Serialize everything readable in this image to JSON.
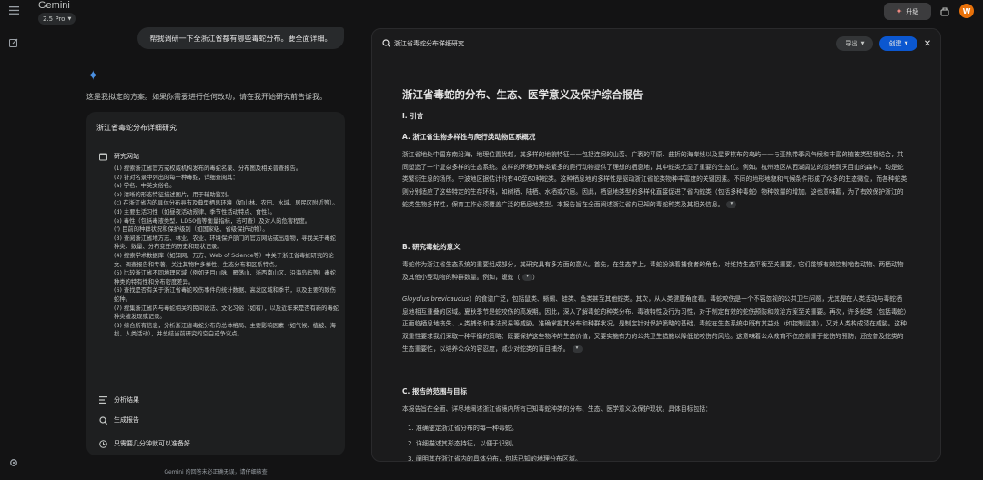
{
  "header": {
    "brand": "Gemini",
    "model": "2.5 Pro",
    "upgrade_label": "升级",
    "avatar_initial": "W"
  },
  "chat": {
    "user_message": "帮我调研一下全浙江省都有哪些毒蛇分布。要全面详细。",
    "plan_intro": "这是我拟定的方案。如果你需要进行任何改动，请在我开始研究前告诉我。",
    "plan": {
      "title": "浙江省毒蛇分布详细研究",
      "section_research": "研究网站",
      "steps": [
        "(1) 搜索浙江省官方或权威机构发布的毒蛇名录、分布图及相关普查报告。",
        "(2) 针对名录中列出的每一种毒蛇，详细查阅其：",
        "(a) 学名、中英文俗名。",
        "(b) 清晰的形态特征描述图片，用于辅助鉴别。",
        "(c) 在浙江省内的具体分布县市及典型栖息环境（如山林、农田、水域、居民区附近等）。",
        "(d) 主要生活习性（如昼夜活动规律、季节性活动特点、食性）。",
        "(e) 毒性（包括毒液类型、LD50值等衡量指标，若可查）及对人的危害程度。",
        "(f) 目前的种群状况和保护级别（如国家级、省级保护动物）。",
        "(3) 查阅浙江省地方志、林业、农业、环境保护部门的官方网站或出版物，寻找关于毒蛇种类、数量、分布变迁的历史和现状记录。",
        "(4) 搜索学术数据库（如知网、万方、Web of Science等）中关于浙江省毒蛇研究的论文、调查报告和专著，关注其物种多样性、生态分布和区系特点。",
        "(5) 比较浙江省不同地理区域（例如天目山脉、雁荡山、浙西南山区、沿海岛屿等）毒蛇种类的特有性和分布密度差异。",
        "(6) 查找是否有关于浙江省毒蛇咬伤事件的统计数据、高发区域和季节，以及主要的致伤蛇种。",
        "(7) 搜集浙江省内与毒蛇相关的民间说法、文化习俗（如有），以及近年来是否有新的毒蛇种类被发现或记录。",
        "(8) 综合所有信息，分析浙江省毒蛇分布的总体格局、主要影响因素（如气候、植被、海拔、人类活动），并总结当前研究的空白或争议点。"
      ],
      "section_analyze": "分析结果",
      "section_report": "生成报告",
      "section_time": "只需要几分钟就可以准备好"
    },
    "disclaimer": "Gemini 的回答未必正确无误，请仔细核查"
  },
  "panel": {
    "title": "浙江省毒蛇分布详细研究",
    "export_label": "导出",
    "create_label": "创建",
    "report": {
      "title": "浙江省毒蛇的分布、生态、医学意义及保护综合报告",
      "h_intro": "I. 引言",
      "h_a": "A. 浙江省生物多样性与爬行类动物区系概况",
      "p_a": "浙江省地处中国东南沿海，地理位置优越，其多样的地貌特征——包括连绵的山峦、广袤的平原、曲折的海岸线以及星罗棋布的岛屿——与亚热带季风气候和丰富的植被类型相结合，共同塑造了一个复杂多样的生态系统。这样的环境为种类繁多的爬行动物提供了理想的栖息地，其中蛇类尤显了重要的生态位。例如，杭州地区从西湖周边的湿地到天目山的森林，均是蛇类繁衍生息的场所。宁波地区据估计约有40至60种蛇类。这种栖息地的多样性是驱动浙江省蛇类物种丰富度的关键因素。不同的地形地貌和气候条件形成了众多的生态微位，而各种蛇类则分别适应了这些特定的生存环境，如树栖、陆栖、水栖或穴居。因此，栖息地类型的多样化直接促进了省内蛇类（包括多种毒蛇）物种数量的增加。这也意味着，为了有效保护浙江的蛇类生物多样性，保育工作必须覆盖广泛的栖息地类型。本报告旨在全面阐述浙江省内已知的毒蛇种类及其相关信息。",
      "h_b": "B. 研究毒蛇的意义",
      "p_b1": "毒蛇作为浙江省生态系统的重要组成部分，其研究具有多方面的意义。首先，在生态学上，毒蛇扮演着捕食者的角色，对维持生态平衡至关重要，它们能够有效控制啮齿动物、两栖动物及其他小型动物的种群数量。例如，蝮蛇（",
      "p_b2_italic": "Gloydius brevicaudus",
      "p_b2": "）的食谱广泛，包括鼠类、蜥蜴、蛙类、鱼类甚至其他蛇类。其次，从人类健康角度看，毒蛇咬伤是一个不容忽视的公共卫生问题，尤其是在人类活动与毒蛇栖息地相互重叠的区域。夏秋季节是蛇咬伤的高发期。因此，深入了解毒蛇的种类分布、毒液特性及行为习性，对于制定有效的蛇伤预防和救治方案至关重要。再次，许多蛇类（包括毒蛇）正面临栖息地丧失、人类捕杀和非法贸易等威胁。准确掌握其分布和种群状况，是制定针对保护策略的基础。毒蛇在生态系统中既有其益处（如控制鼠害），又对人类构成潜在威胁。这种双重性要求我们采取一种平衡的策略：既要保护这些物种的生态价值，又要实施有力的公共卫生措施以降低蛇咬伤的风险。这意味着公众教育不仅应侧重于蛇伤的预防，还应普及蛇类的生态重要性，以培养公众的容忍度，减少对蛇类的盲目捕杀。",
      "h_c": "C. 报告的范围与目标",
      "p_c": "本报告旨在全面、详尽地阐述浙江省境内所有已知毒蛇种类的分布、生态、医学意义及保护现状。具体目标包括：",
      "list": [
        "1.  准确鉴定浙江省分布的每一种毒蛇。",
        "2.  详细描述其形态特征，以便于识别。",
        "3.  阐明其在浙江省内的具体分布，包括已知的地理分布区域。"
      ]
    }
  },
  "colors": {
    "background": "#131314",
    "card": "#1e1f20",
    "accent_blue": "#0b57d0",
    "avatar": "#e8710a"
  }
}
